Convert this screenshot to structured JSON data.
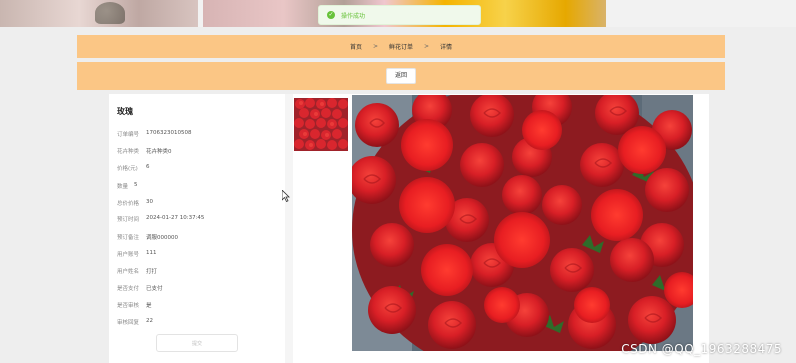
{
  "toast": {
    "text": "操作成功",
    "icon": "check-circle-icon",
    "color": "#67c23a"
  },
  "breadcrumb": {
    "items": [
      "首页",
      "鲜花订单",
      "详情"
    ],
    "separator": ">"
  },
  "actions": {
    "back_label": "返回"
  },
  "product": {
    "title": "玫瑰",
    "fields": [
      {
        "label": "订单编号",
        "value": "1706323010508"
      },
      {
        "label": "花卉种类",
        "value": "花卉种类0"
      },
      {
        "label": "价格(元)",
        "value": "6"
      },
      {
        "label": "数量",
        "value": "5"
      },
      {
        "label": "总价价格",
        "value": "30"
      },
      {
        "label": "预订时间",
        "value": "2024-01-27 10:37:45"
      },
      {
        "label": "预订备注",
        "value": "调服000000"
      },
      {
        "label": "用户账号",
        "value": "111"
      },
      {
        "label": "用户姓名",
        "value": "打打"
      },
      {
        "label": "是否支付",
        "value": "已支付"
      },
      {
        "label": "是否审核",
        "value": "是"
      },
      {
        "label": "审核回复",
        "value": "22"
      }
    ],
    "disabled_button_label": "提交"
  },
  "watermark": "CSDN @QQ_1963288475",
  "colors": {
    "accent_bar": "#fbc685",
    "background": "#eeeeee"
  }
}
